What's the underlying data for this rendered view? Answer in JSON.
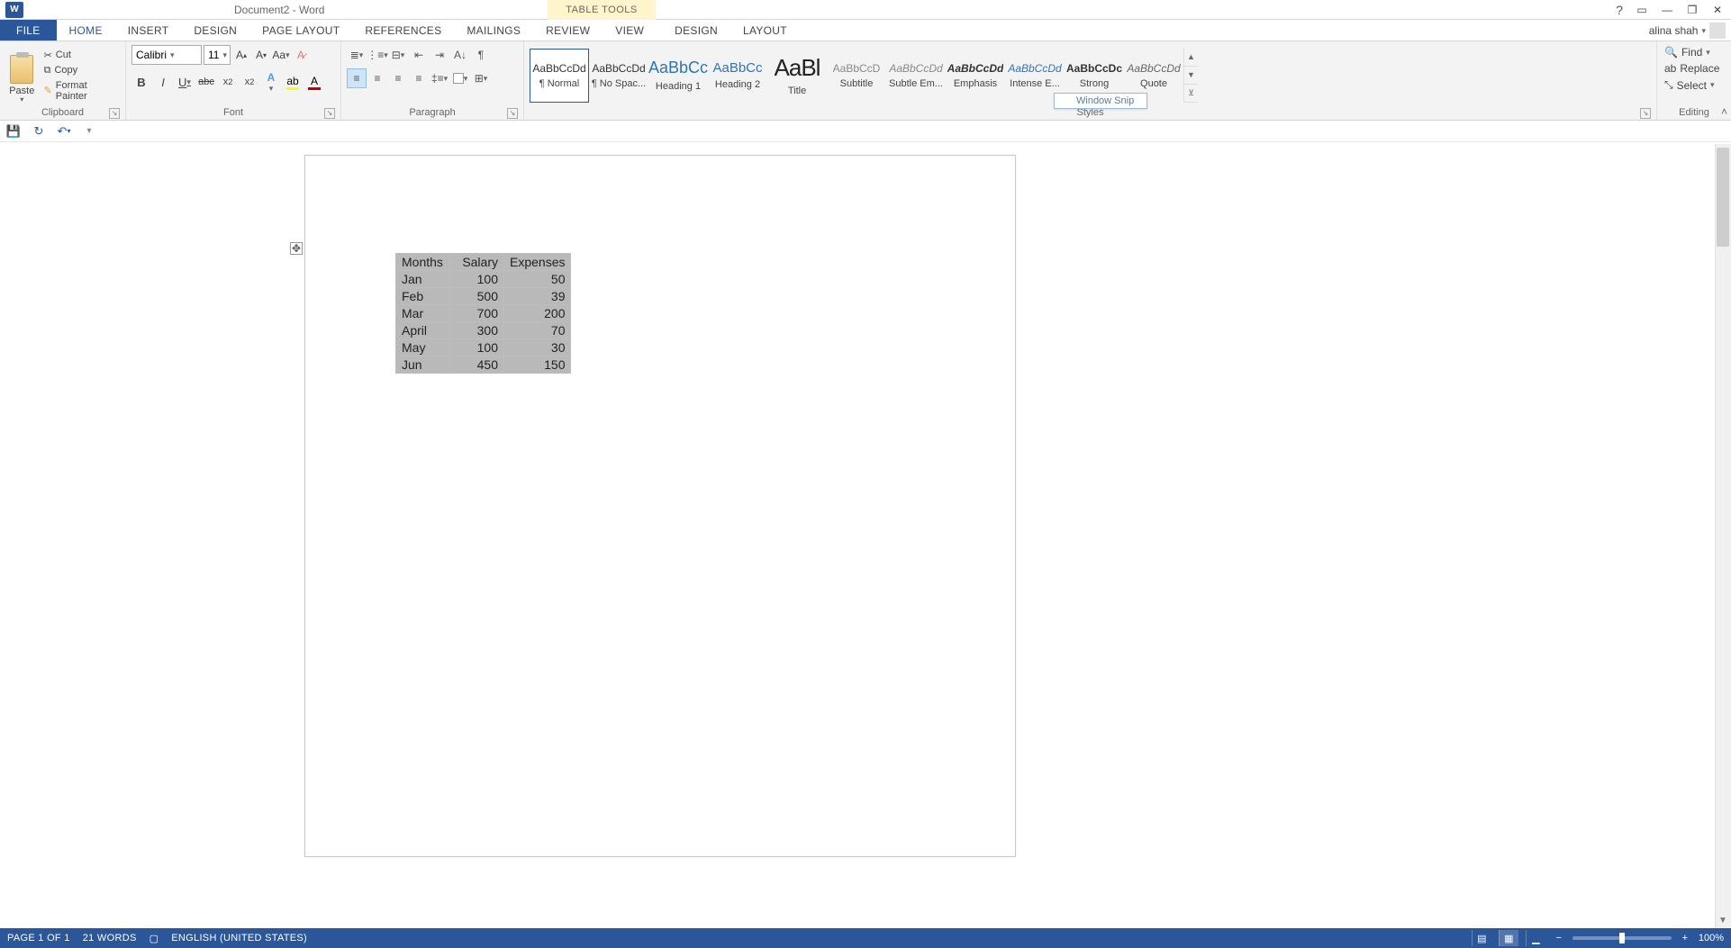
{
  "title": "Document2 - Word",
  "table_tools_label": "TABLE TOOLS",
  "user_name": "alina shah",
  "tabs": {
    "file": "FILE",
    "home": "HOME",
    "insert": "INSERT",
    "design": "DESIGN",
    "page_layout": "PAGE LAYOUT",
    "references": "REFERENCES",
    "mailings": "MAILINGS",
    "review": "REVIEW",
    "view": "VIEW",
    "tt_design": "DESIGN",
    "tt_layout": "LAYOUT"
  },
  "clipboard": {
    "paste": "Paste",
    "cut": "Cut",
    "copy": "Copy",
    "format_painter": "Format Painter",
    "label": "Clipboard"
  },
  "font": {
    "name": "Calibri",
    "size": "11",
    "label": "Font"
  },
  "paragraph": {
    "label": "Paragraph"
  },
  "styles": {
    "label": "Styles",
    "items": [
      {
        "preview": "AaBbCcDd",
        "name": "¶ Normal",
        "selected": true,
        "css": "font-size:12px;"
      },
      {
        "preview": "AaBbCcDd",
        "name": "¶ No Spac...",
        "selected": false,
        "css": "font-size:12px;"
      },
      {
        "preview": "AaBbCc",
        "name": "Heading 1",
        "selected": false,
        "css": "font-size:18px;color:#2e74b5;"
      },
      {
        "preview": "AaBbCc",
        "name": "Heading 2",
        "selected": false,
        "css": "font-size:15px;color:#2e74b5;"
      },
      {
        "preview": "AaBl",
        "name": "Title",
        "selected": false,
        "css": "font-size:26px;color:#222;letter-spacing:-1px;"
      },
      {
        "preview": "AaBbCcD",
        "name": "Subtitle",
        "selected": false,
        "css": "font-size:12px;color:#888;"
      },
      {
        "preview": "AaBbCcDd",
        "name": "Subtle Em...",
        "selected": false,
        "css": "font-size:12px;font-style:italic;color:#888;"
      },
      {
        "preview": "AaBbCcDd",
        "name": "Emphasis",
        "selected": false,
        "css": "font-size:12px;font-style:italic;font-weight:bold;"
      },
      {
        "preview": "AaBbCcDd",
        "name": "Intense E...",
        "selected": false,
        "css": "font-size:12px;font-style:italic;color:#2e74b5;"
      },
      {
        "preview": "AaBbCcDc",
        "name": "Strong",
        "selected": false,
        "css": "font-size:12px;font-weight:bold;"
      },
      {
        "preview": "AaBbCcDd",
        "name": "Quote",
        "selected": false,
        "css": "font-size:12px;font-style:italic;color:#666;"
      }
    ]
  },
  "editing": {
    "find": "Find",
    "replace": "Replace",
    "select": "Select",
    "label": "Editing"
  },
  "snip_tip": "Window Snip",
  "table": {
    "headers": [
      "Months",
      "Salary",
      "Expenses"
    ],
    "rows": [
      [
        "Jan",
        "100",
        "50"
      ],
      [
        "Feb",
        "500",
        "39"
      ],
      [
        "Mar",
        "700",
        "200"
      ],
      [
        "April",
        "300",
        "70"
      ],
      [
        "May",
        "100",
        "30"
      ],
      [
        "Jun",
        "450",
        "150"
      ]
    ]
  },
  "status": {
    "page": "PAGE 1 OF 1",
    "words": "21 WORDS",
    "language": "ENGLISH (UNITED STATES)",
    "zoom": "100%"
  }
}
